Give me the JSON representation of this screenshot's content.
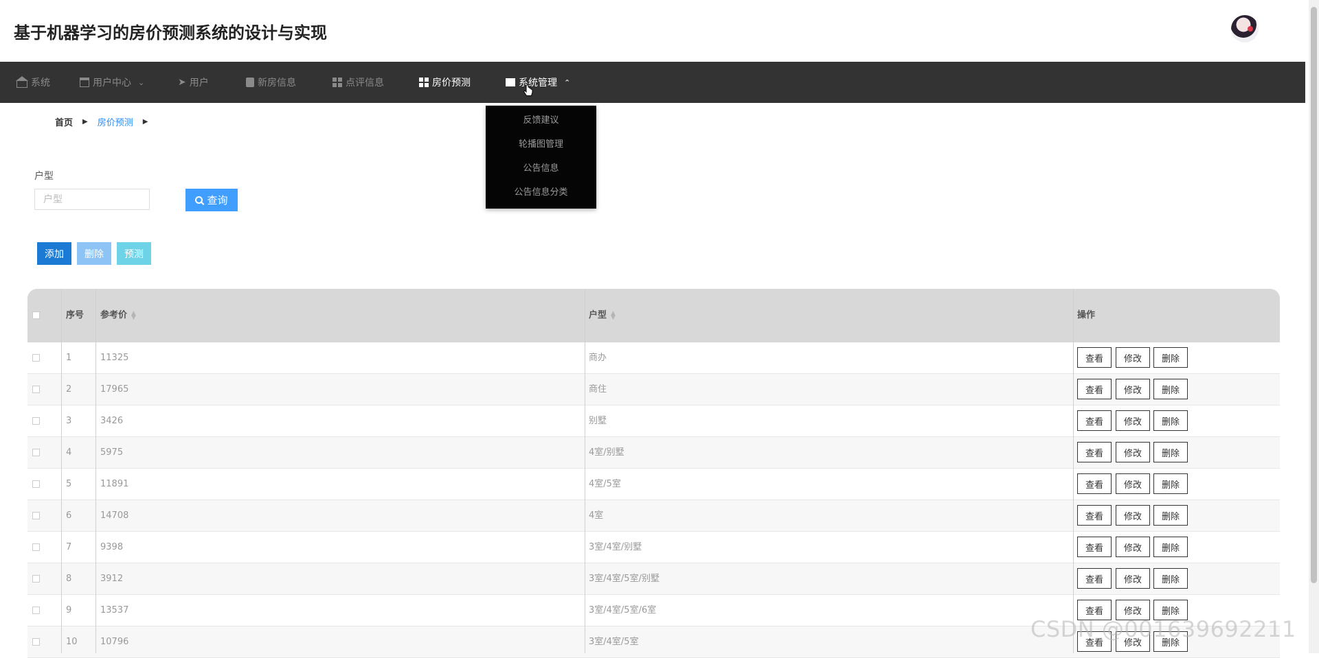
{
  "header": {
    "title": "基于机器学习的房价预测系统的设计与实现"
  },
  "nav": {
    "items": [
      {
        "label": "系统",
        "icon": "home-icon"
      },
      {
        "label": "用户中心",
        "icon": "card-icon",
        "caret": "⌄"
      },
      {
        "label": "用户",
        "icon": "paper-plane-icon"
      },
      {
        "label": "新房信息",
        "icon": "clipboard-icon"
      },
      {
        "label": "点评信息",
        "icon": "grid-icon"
      },
      {
        "label": "房价预测",
        "icon": "grid-icon"
      },
      {
        "label": "系统管理",
        "icon": "monitor-icon",
        "caret": "⌃"
      }
    ],
    "dropdown": [
      "反馈建议",
      "轮播图管理",
      "公告信息",
      "公告信息分类"
    ]
  },
  "breadcrumb": {
    "home": "首页",
    "current": "房价预测"
  },
  "search": {
    "label": "户型",
    "placeholder": "户型",
    "value": "",
    "button": "查询"
  },
  "actions": {
    "add": "添加",
    "delete": "删除",
    "predict": "预测"
  },
  "table": {
    "headers": {
      "index": "序号",
      "price": "参考价",
      "type": "户型",
      "ops": "操作"
    },
    "op_labels": {
      "view": "查看",
      "edit": "修改",
      "delete": "删除"
    },
    "rows": [
      {
        "index": "1",
        "price": "11325",
        "type": "商办"
      },
      {
        "index": "2",
        "price": "17965",
        "type": "商住"
      },
      {
        "index": "3",
        "price": "3426",
        "type": "别墅"
      },
      {
        "index": "4",
        "price": "5975",
        "type": "4室/别墅"
      },
      {
        "index": "5",
        "price": "11891",
        "type": "4室/5室"
      },
      {
        "index": "6",
        "price": "14708",
        "type": "4室"
      },
      {
        "index": "7",
        "price": "9398",
        "type": "3室/4室/别墅"
      },
      {
        "index": "8",
        "price": "3912",
        "type": "3室/4室/5室/别墅"
      },
      {
        "index": "9",
        "price": "13537",
        "type": "3室/4室/5室/6室"
      },
      {
        "index": "10",
        "price": "10796",
        "type": "3室/4室/5室"
      }
    ]
  },
  "watermark": "CSDN @001639692211",
  "colors": {
    "navbar": "#333333",
    "primary": "#409eff",
    "add": "#1a7ad4",
    "delete": "#8ec4f5",
    "predict": "#6fd3e8"
  }
}
